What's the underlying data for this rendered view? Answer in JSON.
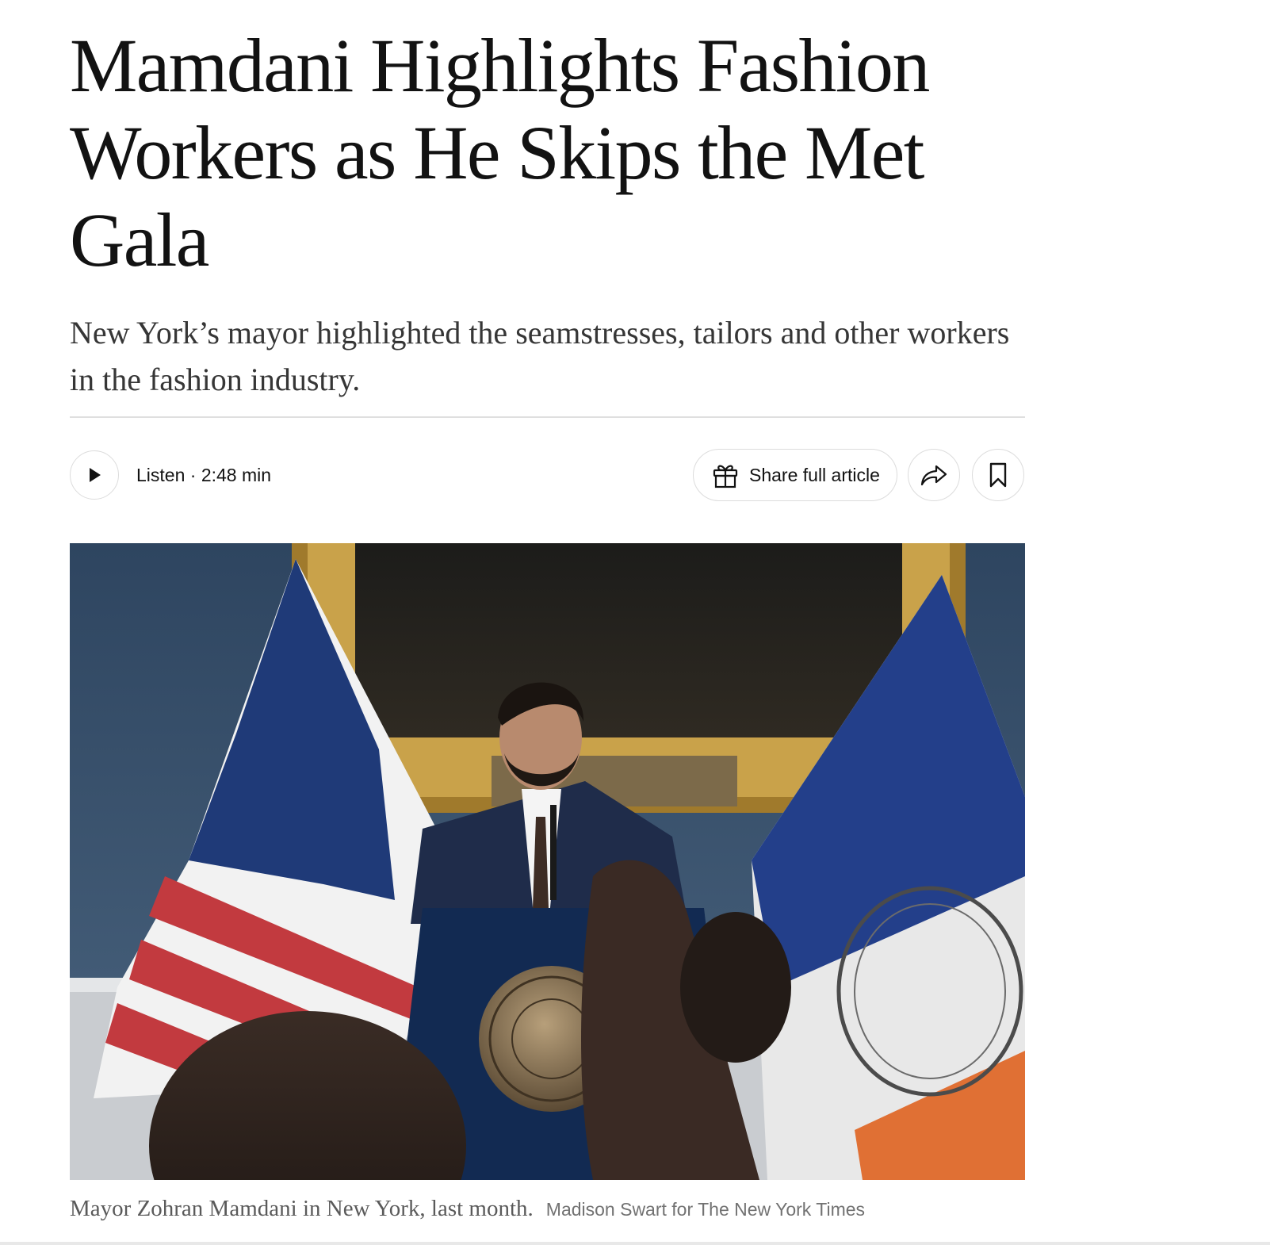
{
  "article": {
    "headline": "Mamdani Highlights Fashion Workers as He Skips the Met Gala",
    "summary": "New York’s mayor highlighted the seamstresses, tailors and other workers in the fashion industry."
  },
  "toolbar": {
    "play_icon": "play-icon",
    "listen_label": "Listen · 2:48 min",
    "share_full_label": "Share full article",
    "gift_icon": "gift-icon",
    "share_icon": "share-arrow-icon",
    "save_icon": "bookmark-icon"
  },
  "photo": {
    "caption": "Mayor Zohran Mamdani in New York, last month.",
    "credit": "Madison Swart for The New York Times"
  },
  "colors": {
    "text": "#121212",
    "summary": "#363636",
    "caption": "#5a5a5a",
    "credit": "#727272",
    "border": "#dcdcdc"
  }
}
